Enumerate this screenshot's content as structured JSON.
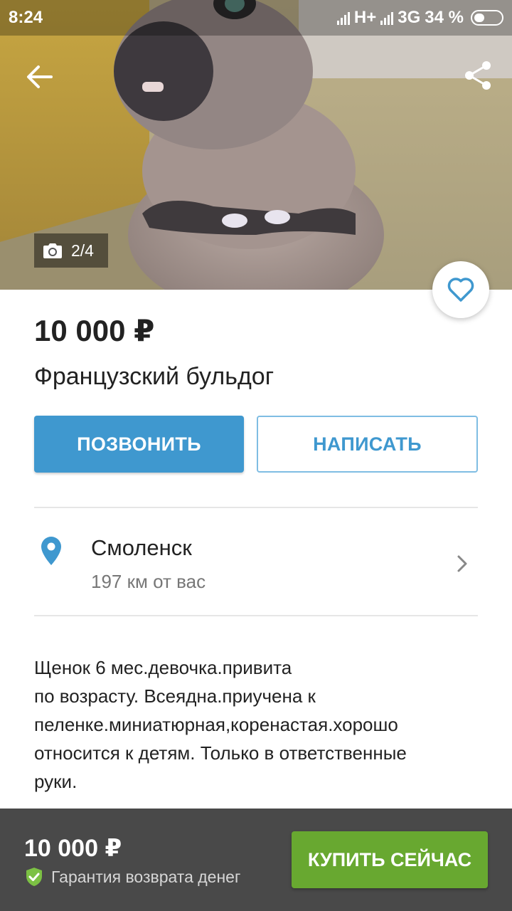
{
  "status_bar": {
    "time": "8:24",
    "network_1": "H+",
    "network_2": "3G",
    "battery": "34 %"
  },
  "photo": {
    "counter": "2/4",
    "icons": {
      "back": "arrow-left-icon",
      "share": "share-icon",
      "camera": "camera-icon",
      "favorite": "heart-icon"
    }
  },
  "listing": {
    "price": "10 000 ₽",
    "title": "Французский бульдог"
  },
  "actions": {
    "call_label": "ПОЗВОНИТЬ",
    "write_label": "НАПИСАТЬ"
  },
  "location": {
    "city": "Смоленск",
    "distance": "197 км от вас",
    "icon": "location-pin-icon"
  },
  "description": {
    "lines": [
      "Щенок 6 мес.девочка.привита",
      "по возрасту. Всеядна.приучена к",
      "пеленке.миниатюрная,коренастая.хорошо",
      "относится к детям. Только в ответственные",
      "руки."
    ]
  },
  "bottom_bar": {
    "price": "10 000 ₽",
    "guarantee": "Гарантия возврата денег",
    "buy_label": "КУПИТЬ СЕЙЧАС"
  },
  "colors": {
    "accent_blue": "#3f98cf",
    "buy_green": "#68a830",
    "bottom_bar_bg": "#494949",
    "shield_green": "#7cc144"
  }
}
